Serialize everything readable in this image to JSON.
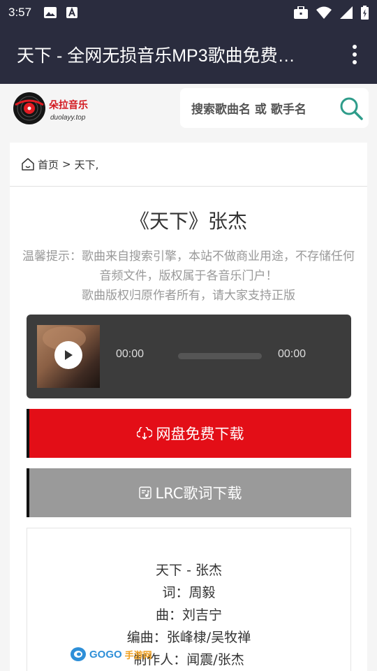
{
  "status_bar": {
    "time": "3:57",
    "left_icons": [
      "image-icon",
      "font-icon"
    ],
    "right_icons": [
      "briefcase-icon",
      "wifi-icon",
      "signal-icon",
      "battery-icon"
    ]
  },
  "app_bar": {
    "title": "天下 - 全网无损音乐MP3歌曲免费…"
  },
  "site": {
    "logo_text": "朵拉音乐",
    "logo_domain": "duolayy.top",
    "search_placeholder": "搜索歌曲名 或 歌手名"
  },
  "breadcrumb": {
    "home": "首页",
    "separator": ">",
    "current": "天下,"
  },
  "song": {
    "title": "《天下》张杰",
    "notice_line1": "温馨提示：歌曲来自搜索引擎，本站不做商业用途，不存储任何音频文件，版权属于各音乐门户！",
    "notice_line2": "歌曲版权归原作者所有，请大家支持正版"
  },
  "player": {
    "current_time": "00:00",
    "duration": "00:00",
    "progress": 0
  },
  "buttons": {
    "download": "网盘免费下载",
    "lrc": "LRC歌词下载"
  },
  "lyrics": [
    "天下 - 张杰",
    "词：周毅",
    "曲：刘吉宁",
    "编曲：张峰棣/吴牧禅",
    "制作人：闻震/张杰"
  ],
  "watermark": {
    "text_a": "GOGO",
    "text_b": "手游网"
  },
  "colors": {
    "app_bar": "#2a2c3e",
    "download_button": "#e30e17",
    "lrc_button": "#9a9a9a",
    "search_icon": "#2e9c8a"
  }
}
